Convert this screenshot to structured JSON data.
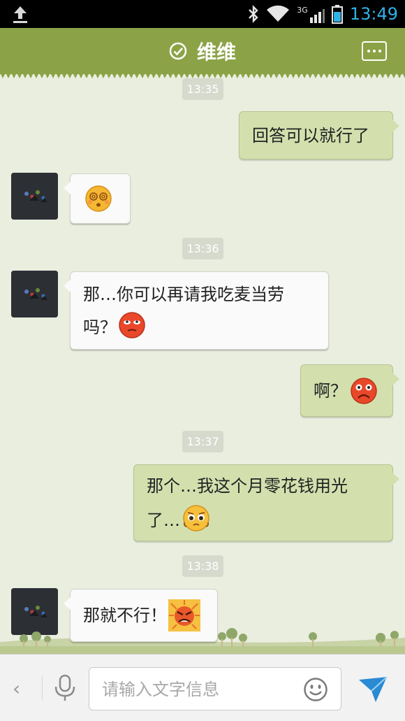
{
  "status_bar": {
    "time": "13:49",
    "network_label": "3G"
  },
  "header": {
    "contact_name": "维维"
  },
  "messages": [
    {
      "type": "timestamp",
      "text": "13:35"
    },
    {
      "type": "out",
      "text": "回答可以就行了"
    },
    {
      "type": "in",
      "text": "",
      "emoji": "dizzy-face"
    },
    {
      "type": "timestamp",
      "text": "13:36"
    },
    {
      "type": "in",
      "line1": "那…你可以再请我吃麦当劳",
      "line2": "吗？",
      "emoji": "rolling-eyes-face"
    },
    {
      "type": "out",
      "text": "啊？",
      "emoji": "shocked-face"
    },
    {
      "type": "timestamp",
      "text": "13:37"
    },
    {
      "type": "out",
      "line1": "那个…我这个月零花钱用光",
      "line2": "了…",
      "emoji": "pleading-face"
    },
    {
      "type": "timestamp",
      "text": "13:38"
    },
    {
      "type": "in",
      "text": "那就不行！",
      "emoji": "angry-face"
    }
  ],
  "input": {
    "placeholder": "请输入文字信息"
  },
  "colors": {
    "header_bg": "#8ba346",
    "out_bubble": "#d3e0ae",
    "in_bubble": "#fafafa",
    "status_accent": "#2fb2e6",
    "send_accent": "#2a8ad4"
  }
}
